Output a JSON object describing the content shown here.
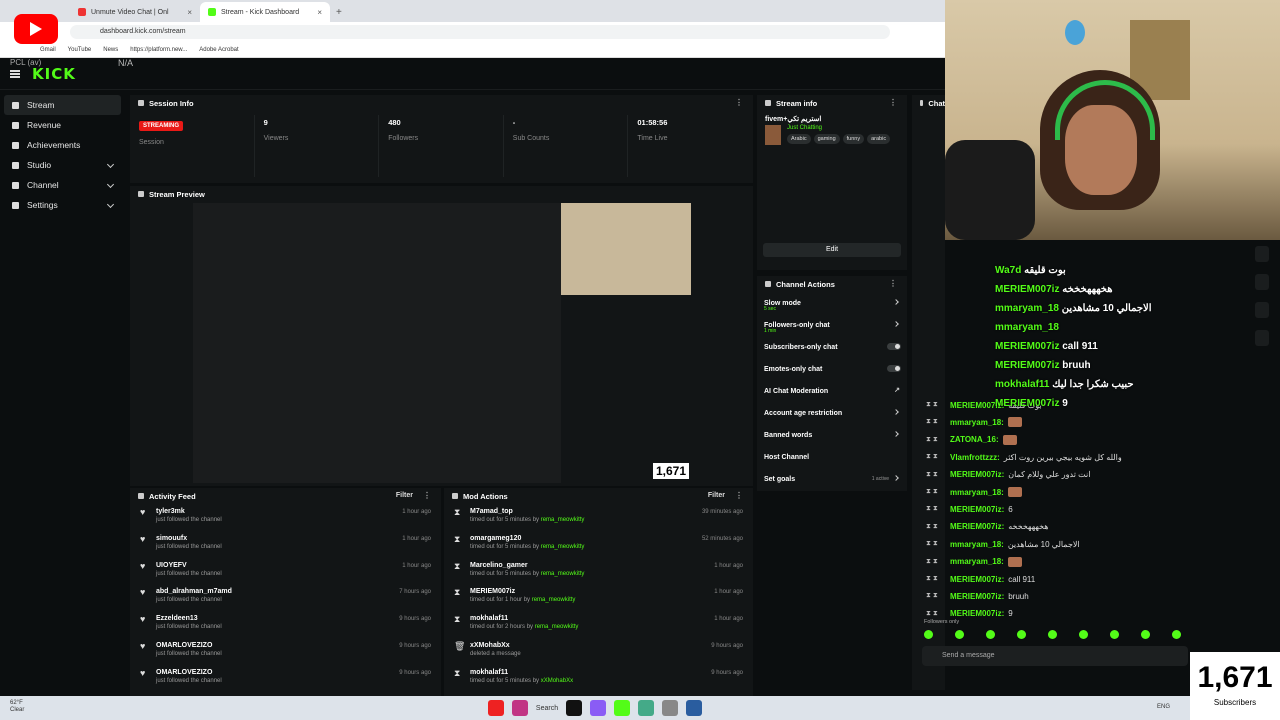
{
  "browser": {
    "tabs": [
      {
        "title": "Unmute Video Chat | Onl"
      },
      {
        "title": "Stream - Kick Dashboard"
      }
    ],
    "url": "dashboard.kick.com/stream",
    "bookmarks": [
      "Gmail",
      "YouTube",
      "News",
      "https://platform.new...",
      "Adobe Acrobat"
    ]
  },
  "header": {
    "logo": "KICK",
    "channel_label": "PCL (av)",
    "na": "N/A"
  },
  "sidebar": {
    "items": [
      {
        "label": "Stream"
      },
      {
        "label": "Revenue"
      },
      {
        "label": "Achievements"
      },
      {
        "label": "Studio"
      },
      {
        "label": "Channel"
      },
      {
        "label": "Settings"
      }
    ]
  },
  "session": {
    "title": "Session Info",
    "status": "STREAMING",
    "status_label": "Session",
    "cells": [
      {
        "value": "9",
        "label": "Viewers"
      },
      {
        "value": "480",
        "label": "Followers"
      },
      {
        "value": "-",
        "label": "Sub Counts"
      },
      {
        "value": "01:58:56",
        "label": "Time Live"
      }
    ]
  },
  "preview": {
    "title": "Stream Preview",
    "viewer_count": "1,671"
  },
  "stream_info": {
    "title": "Stream info",
    "stream_title": "fivem+استريم تكي",
    "category": "Just Chatting",
    "tags": [
      "Arabic",
      "gaming",
      "funny",
      "arabic"
    ],
    "edit_label": "Edit"
  },
  "channel_actions": {
    "title": "Channel Actions",
    "items": [
      {
        "label": "Slow mode",
        "sub": "5 sec"
      },
      {
        "label": "Followers-only chat",
        "sub": "1 min"
      },
      {
        "label": "Subscribers-only chat",
        "sub": ""
      },
      {
        "label": "Emotes-only chat",
        "sub": ""
      },
      {
        "label": "AI Chat Moderation",
        "sub": ""
      },
      {
        "label": "Account age restriction",
        "sub": ""
      },
      {
        "label": "Banned words",
        "sub": ""
      },
      {
        "label": "Host Channel",
        "sub": ""
      },
      {
        "label": "Set goals",
        "sub": ""
      }
    ],
    "goals_active": "1 active"
  },
  "activity_feed": {
    "title": "Activity Feed",
    "filter": "Filter",
    "items": [
      {
        "name": "tyler3mk",
        "action": "just followed the channel",
        "time": "1 hour ago"
      },
      {
        "name": "simouufx",
        "action": "just followed the channel",
        "time": "1 hour ago"
      },
      {
        "name": "UIOYEFV",
        "action": "just followed the channel",
        "time": "1 hour ago"
      },
      {
        "name": "abd_alrahman_m7amd",
        "action": "just followed the channel",
        "time": "7 hours ago"
      },
      {
        "name": "Ezzeldeen13",
        "action": "just followed the channel",
        "time": "9 hours ago"
      },
      {
        "name": "OMARLOVEZIZO",
        "action": "just followed the channel",
        "time": "9 hours ago"
      },
      {
        "name": "OMARLOVEZIZO",
        "action": "just followed the channel",
        "time": "9 hours ago"
      }
    ]
  },
  "mod_actions": {
    "title": "Mod Actions",
    "filter": "Filter",
    "items": [
      {
        "name": "M7amad_top",
        "action": "timed out for 5 minutes by",
        "mod": "rema_meowkitty",
        "time": "39 minutes ago"
      },
      {
        "name": "omargameg120",
        "action": "timed out for 5 minutes by",
        "mod": "rema_meowkitty",
        "time": "52 minutes ago"
      },
      {
        "name": "Marcelino_gamer",
        "action": "timed out for 5 minutes by",
        "mod": "rema_meowkitty",
        "time": "1 hour ago"
      },
      {
        "name": "MERIEM007iz",
        "action": "timed out for 1 hour by",
        "mod": "rema_meowkitty",
        "time": "1 hour ago"
      },
      {
        "name": "mokhalaf11",
        "action": "timed out for 2 hours by",
        "mod": "rema_meowkitty",
        "time": "1 hour ago"
      },
      {
        "name": "xXMohabXx",
        "action": "deleted a message",
        "mod": "",
        "time": "9 hours ago"
      },
      {
        "name": "mokhalaf11",
        "action": "timed out for 5 minutes by",
        "mod": "xXMohabXx",
        "time": "9 hours ago"
      }
    ]
  },
  "chat": {
    "title": "Chat",
    "lines": [
      {
        "user": "MERIEM007iz:",
        "msg": "بوت قليقه"
      },
      {
        "user": "mmaryam_18:",
        "msg": ""
      },
      {
        "user": "ZATONA_16:",
        "msg": ""
      },
      {
        "user": "Vlamfrottzzz:",
        "msg": "والله كل شويه بيجي بيرين روت اكثر"
      },
      {
        "user": "MERIEM007iz:",
        "msg": "انت تدور علي وللام كمان"
      },
      {
        "user": "mmaryam_18:",
        "msg": ""
      },
      {
        "user": "MERIEM007iz:",
        "msg": "6"
      },
      {
        "user": "MERIEM007iz:",
        "msg": "هخهههخخخه"
      },
      {
        "user": "mmaryam_18:",
        "msg": "الاجمالي 10 مشاهدين"
      },
      {
        "user": "mmaryam_18:",
        "msg": ""
      },
      {
        "user": "MERIEM007iz:",
        "msg": "call 911"
      },
      {
        "user": "MERIEM007iz:",
        "msg": "bruuh"
      },
      {
        "user": "MERIEM007iz:",
        "msg": "9"
      }
    ],
    "followers_only": "Followers only",
    "input_placeholder": "Send a message"
  },
  "overlay": {
    "lines": [
      {
        "user": "Wa7d",
        "msg": "بوت قليقه"
      },
      {
        "user": "MERIEM007iz",
        "msg": "هخهههخخخه"
      },
      {
        "user": "mmaryam_18",
        "msg": "الاجمالي 10 مشاهدين"
      },
      {
        "user": "mmaryam_18",
        "msg": ""
      },
      {
        "user": "MERIEM007iz",
        "msg": "call 911"
      },
      {
        "user": "MERIEM007iz",
        "msg": "bruuh"
      },
      {
        "user": "mokhalaf11",
        "msg": "حبيب شكرا جدا ليك"
      },
      {
        "user": "MERIEM007iz",
        "msg": "9"
      }
    ]
  },
  "sub_counter": {
    "count": "1,671",
    "label": "Subscribers"
  },
  "taskbar": {
    "weather_temp": "62°F",
    "weather_desc": "Clear",
    "search": "Search",
    "lang": "ENG"
  }
}
